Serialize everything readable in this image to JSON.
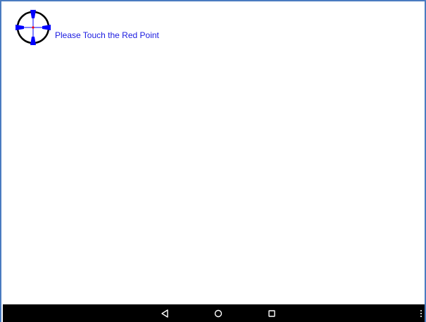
{
  "calibration": {
    "instruction": "Please Touch the Red Point",
    "target_icon": "crosshair-target-icon",
    "text_color": "#1a1ae0",
    "marker_color": "#0000ff",
    "center_point_color": "#ff0000"
  },
  "navbar": {
    "back_icon": "back-triangle-icon",
    "home_icon": "home-circle-icon",
    "recents_icon": "recents-square-icon",
    "menu_icon": "overflow-menu-icon",
    "background": "#000000"
  }
}
